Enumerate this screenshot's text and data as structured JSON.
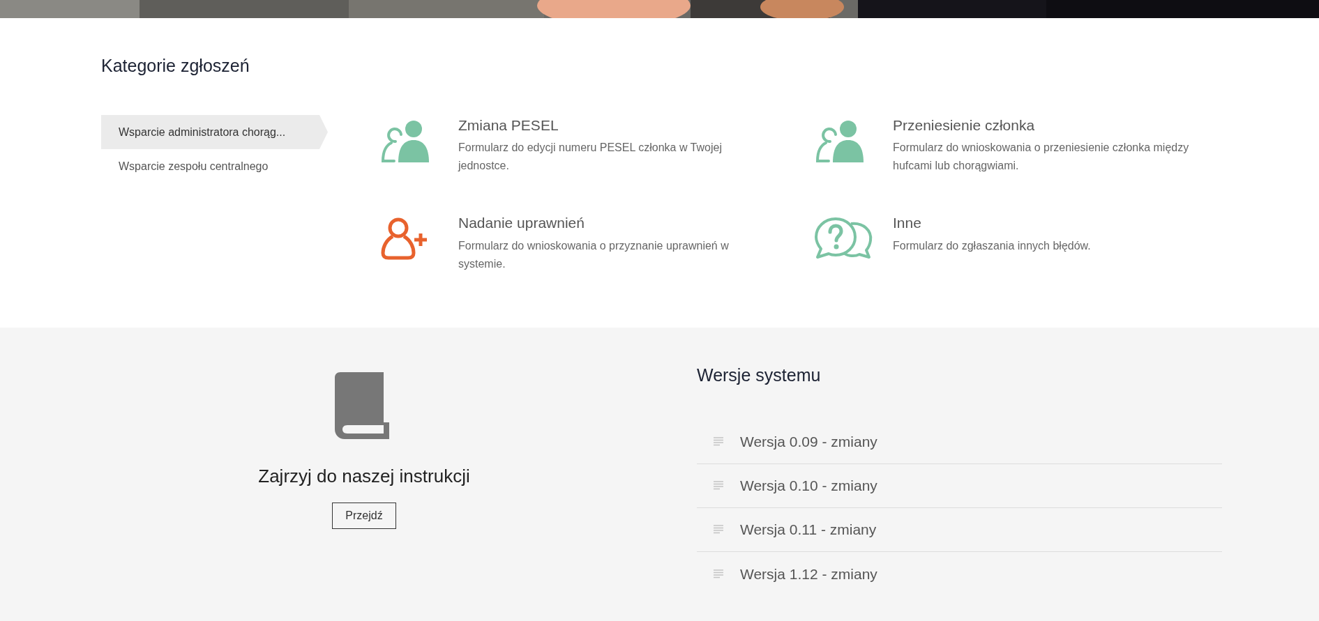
{
  "categories": {
    "title": "Kategorie zgłoszeń",
    "sidebar": [
      {
        "label": "Wsparcie administratora chorąg...",
        "selected": true
      },
      {
        "label": "Wsparcie zespołu centralnego",
        "selected": false
      }
    ],
    "cards": [
      {
        "kind": "person-swap",
        "color": "#7bc3a3",
        "title": "Zmiana PESEL",
        "description": "Formularz do edycji numeru PESEL członka w Twojej jednostce."
      },
      {
        "kind": "person-swap",
        "color": "#7bc3a3",
        "title": "Przeniesienie członka",
        "description": "Formularz do wnioskowania o przeniesienie członka między hufcami lub chorągwiami."
      },
      {
        "kind": "person-add",
        "color": "#e8622d",
        "title": "Nadanie uprawnień",
        "description": "Formularz do wnioskowania o przyznanie uprawnień w systemie."
      },
      {
        "kind": "question",
        "color": "#7bc3a3",
        "title": "Inne",
        "description": "Formularz do zgłaszania innych błędów."
      }
    ]
  },
  "manual": {
    "title": "Zajrzyj do naszej instrukcji",
    "button": "Przejdź"
  },
  "versions": {
    "title": "Wersje systemu",
    "items": [
      "Wersja 0.09 - zmiany",
      "Wersja 0.10 - zmiany",
      "Wersja 0.11 - zmiany",
      "Wersja 1.12 - zmiany"
    ]
  }
}
